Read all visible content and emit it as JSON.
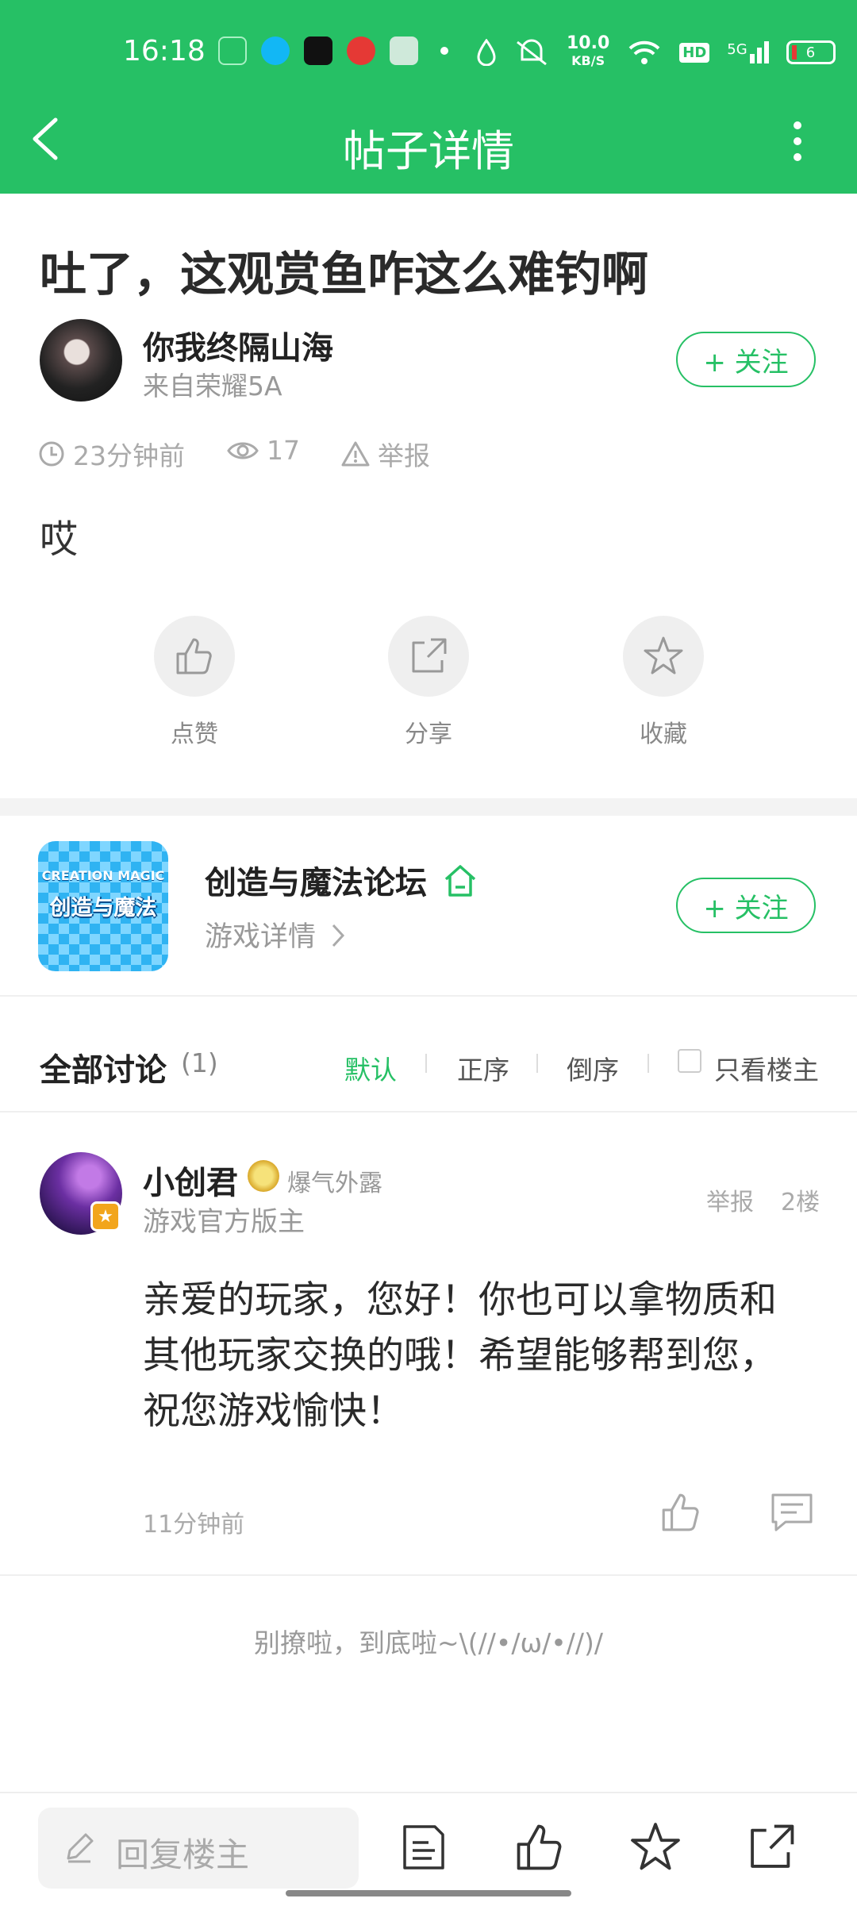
{
  "status_bar": {
    "time": "16:18",
    "net_speed_value": "10.0",
    "net_speed_unit": "KB/S",
    "hd": "HD",
    "net_type": "5G",
    "battery": "6"
  },
  "nav": {
    "title": "帖子详情"
  },
  "post": {
    "title": "吐了，这观赏鱼咋这么难钓啊",
    "author": "你我终隔山海",
    "device": "来自荣耀5A",
    "follow_label": "+ 关注",
    "time": "23分钟前",
    "views": "17",
    "report": "举报",
    "body": "哎",
    "actions": {
      "like": "点赞",
      "share": "分享",
      "favorite": "收藏"
    }
  },
  "forum": {
    "icon_text_top": "CREATION MAGIC",
    "icon_text": "创造与魔法",
    "name": "创造与魔法论坛",
    "detail": "游戏详情",
    "follow_label": "+ 关注"
  },
  "discussion": {
    "title": "全部讨论",
    "count": "(1)",
    "sort_default": "默认",
    "sort_asc": "正序",
    "sort_desc": "倒序",
    "only_op": "只看楼主"
  },
  "comment": {
    "name": "小创君",
    "medal": "爆气外露",
    "role": "游戏官方版主",
    "report": "举报",
    "floor": "2楼",
    "text": "亲爱的玩家，您好！你也可以拿物质和其他玩家交换的哦！希望能够帮到您，祝您游戏愉快！",
    "time": "11分钟前"
  },
  "end_text": "别撩啦，到底啦~\\(//•/ω/•//)/",
  "bottom": {
    "reply_placeholder": "回复楼主"
  },
  "colors": {
    "accent": "#26c065"
  }
}
